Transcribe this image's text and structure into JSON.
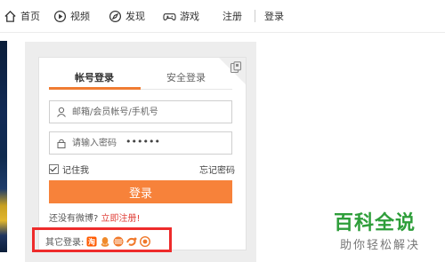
{
  "nav": {
    "home": "首页",
    "video": "视频",
    "discover": "发现",
    "game": "游戏",
    "register": "注册",
    "login": "登录"
  },
  "login_card": {
    "tab_account": "帐号登录",
    "tab_safe": "安全登录",
    "username_placeholder": "邮箱/会员帐号/手机号",
    "password_hint": "请输入密码",
    "password_mask": "••••••",
    "remember_me": "记住我",
    "forgot_password": "忘记密码",
    "login_button": "登录",
    "no_weibo_prompt": "还没有微博?",
    "register_now": "立即注册!",
    "other_login_label": "其它登录:",
    "other_login_icons": [
      "taobao-icon",
      "qq-icon",
      "netease-icon",
      "tianyi-icon",
      "baidu-icon"
    ]
  },
  "watermark": {
    "title": "百科全说",
    "subtitle": "助你轻松解决"
  },
  "colors": {
    "accent": "#f7823a",
    "highlight": "#ee2b2b",
    "watermark": "#2e9e3a"
  }
}
